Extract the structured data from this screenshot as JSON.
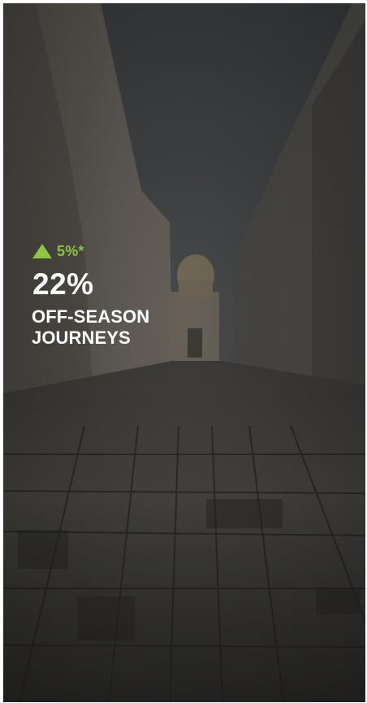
{
  "stat": {
    "change": "5%*",
    "value": "22%",
    "label_lines": [
      "OFF-SEASON",
      "JOURNEYS"
    ]
  },
  "icons": {
    "trend": "up-triangle-icon"
  },
  "colors": {
    "accent": "#8cc63f",
    "text": "#ffffff",
    "overlay": "#00000066"
  }
}
